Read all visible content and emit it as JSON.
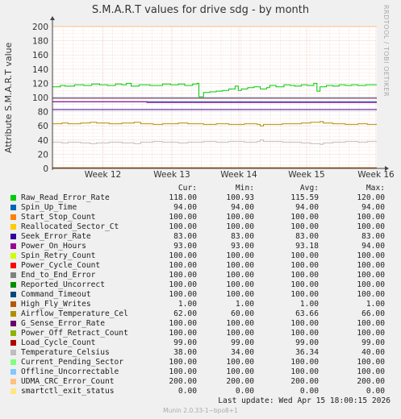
{
  "chart_data": {
    "type": "line",
    "title": "S.M.A.R.T values for drive sdg - by month",
    "ylabel": "Attribute S.M.A.R.T value",
    "xlabel": "",
    "ylim": [
      0,
      200
    ],
    "y_ticks": [
      "0",
      "20",
      "40",
      "60",
      "80",
      "100",
      "120",
      "140",
      "160",
      "180",
      "200"
    ],
    "x_ticks": [
      "Week 12",
      "Week 13",
      "Week 14",
      "Week 15",
      "Week 16"
    ],
    "grid": true,
    "legend_columns": [
      "Cur:",
      "Min:",
      "Avg:",
      "Max:"
    ],
    "series": [
      {
        "name": "Raw_Read_Error_Rate",
        "color": "#00cc00",
        "cur": "118.00",
        "min": "100.93",
        "avg": "115.59",
        "max": "120.00",
        "points": [
          [
            0,
            115
          ],
          [
            5,
            115
          ],
          [
            5,
            117
          ],
          [
            8,
            117
          ],
          [
            8,
            116
          ],
          [
            12,
            116
          ],
          [
            12,
            116
          ],
          [
            14,
            116
          ],
          [
            14,
            118
          ],
          [
            20,
            118
          ],
          [
            20,
            117
          ],
          [
            25,
            117
          ],
          [
            25,
            119
          ],
          [
            30,
            119
          ],
          [
            30,
            118
          ],
          [
            35,
            118
          ],
          [
            35,
            117
          ],
          [
            40,
            117
          ],
          [
            40,
            119
          ],
          [
            44,
            119
          ],
          [
            44,
            118
          ],
          [
            47,
            118
          ],
          [
            47,
            120
          ],
          [
            50,
            120
          ],
          [
            50,
            116
          ],
          [
            55,
            116
          ],
          [
            55,
            118
          ],
          [
            62,
            118
          ],
          [
            62,
            117
          ],
          [
            70,
            117
          ],
          [
            70,
            119
          ],
          [
            75,
            119
          ],
          [
            75,
            118
          ],
          [
            80,
            118
          ],
          [
            80,
            119
          ],
          [
            84,
            119
          ],
          [
            84,
            117
          ],
          [
            89,
            117
          ],
          [
            89,
            119
          ],
          [
            92,
            119
          ],
          [
            92,
            120
          ],
          [
            93,
            120
          ],
          [
            93,
            101
          ],
          [
            96,
            101
          ],
          [
            96,
            107
          ],
          [
            100,
            107
          ],
          [
            100,
            108
          ],
          [
            104,
            108
          ],
          [
            104,
            109
          ],
          [
            108,
            109
          ],
          [
            108,
            110
          ],
          [
            112,
            110
          ],
          [
            112,
            112
          ],
          [
            116,
            112
          ],
          [
            116,
            116
          ],
          [
            118,
            116
          ],
          [
            118,
            110
          ],
          [
            120,
            110
          ],
          [
            120,
            112
          ],
          [
            124,
            112
          ],
          [
            124,
            114
          ],
          [
            128,
            114
          ],
          [
            128,
            115
          ],
          [
            132,
            115
          ],
          [
            132,
            112
          ],
          [
            136,
            112
          ],
          [
            136,
            114
          ],
          [
            138,
            114
          ],
          [
            138,
            117
          ],
          [
            142,
            117
          ],
          [
            142,
            115
          ],
          [
            147,
            115
          ],
          [
            147,
            118
          ],
          [
            151,
            118
          ],
          [
            151,
            117
          ],
          [
            154,
            117
          ],
          [
            154,
            116
          ],
          [
            158,
            116
          ],
          [
            158,
            118
          ],
          [
            162,
            118
          ],
          [
            162,
            117
          ],
          [
            166,
            117
          ],
          [
            166,
            120
          ],
          [
            168,
            120
          ],
          [
            168,
            109
          ],
          [
            170,
            109
          ],
          [
            170,
            115
          ],
          [
            174,
            115
          ],
          [
            174,
            117
          ],
          [
            178,
            117
          ],
          [
            178,
            116
          ],
          [
            182,
            116
          ],
          [
            182,
            118
          ],
          [
            186,
            118
          ],
          [
            186,
            117
          ],
          [
            190,
            117
          ],
          [
            190,
            118
          ],
          [
            194,
            118
          ],
          [
            194,
            117
          ],
          [
            199,
            117
          ],
          [
            199,
            118
          ],
          [
            206,
            118
          ]
        ]
      },
      {
        "name": "Spin_Up_Time",
        "color": "#0066b3",
        "cur": "94.00",
        "min": "94.00",
        "avg": "94.00",
        "max": "94.00",
        "points": [
          [
            0,
            94
          ],
          [
            206,
            94
          ]
        ]
      },
      {
        "name": "Start_Stop_Count",
        "color": "#ff8000",
        "cur": "100.00",
        "min": "100.00",
        "avg": "100.00",
        "max": "100.00",
        "points": [
          [
            0,
            100
          ],
          [
            206,
            100
          ]
        ]
      },
      {
        "name": "Reallocated_Sector_Ct",
        "color": "#ffcc00",
        "cur": "100.00",
        "min": "100.00",
        "avg": "100.00",
        "max": "100.00",
        "points": [
          [
            0,
            100
          ],
          [
            206,
            100
          ]
        ]
      },
      {
        "name": "Seek_Error_Rate",
        "color": "#330099",
        "cur": "83.00",
        "min": "83.00",
        "avg": "83.00",
        "max": "83.00",
        "points": [
          [
            0,
            83
          ],
          [
            206,
            83
          ]
        ]
      },
      {
        "name": "Power_On_Hours",
        "color": "#990099",
        "cur": "93.00",
        "min": "93.00",
        "avg": "93.18",
        "max": "94.00",
        "points": [
          [
            0,
            94
          ],
          [
            60,
            94
          ],
          [
            60,
            93
          ],
          [
            206,
            93
          ]
        ]
      },
      {
        "name": "Spin_Retry_Count",
        "color": "#ccff00",
        "cur": "100.00",
        "min": "100.00",
        "avg": "100.00",
        "max": "100.00",
        "points": [
          [
            0,
            100
          ],
          [
            206,
            100
          ]
        ]
      },
      {
        "name": "Power_Cycle_Count",
        "color": "#ff0000",
        "cur": "100.00",
        "min": "100.00",
        "avg": "100.00",
        "max": "100.00",
        "points": [
          [
            0,
            100
          ],
          [
            206,
            100
          ]
        ]
      },
      {
        "name": "End_to_End_Error",
        "color": "#808080",
        "cur": "100.00",
        "min": "100.00",
        "avg": "100.00",
        "max": "100.00",
        "points": [
          [
            0,
            100
          ],
          [
            206,
            100
          ]
        ]
      },
      {
        "name": "Reported_Uncorrect",
        "color": "#008f00",
        "cur": "100.00",
        "min": "100.00",
        "avg": "100.00",
        "max": "100.00",
        "points": [
          [
            0,
            100
          ],
          [
            206,
            100
          ]
        ]
      },
      {
        "name": "Command_Timeout",
        "color": "#00487d",
        "cur": "100.00",
        "min": "100.00",
        "avg": "100.00",
        "max": "100.00",
        "points": [
          [
            0,
            100
          ],
          [
            206,
            100
          ]
        ]
      },
      {
        "name": "High_Fly_Writes",
        "color": "#b35a00",
        "cur": "1.00",
        "min": "1.00",
        "avg": "1.00",
        "max": "1.00",
        "points": [
          [
            0,
            1
          ],
          [
            206,
            1
          ]
        ]
      },
      {
        "name": "Airflow_Temperature_Cel",
        "color": "#b38f00",
        "cur": "62.00",
        "min": "60.00",
        "avg": "63.66",
        "max": "66.00",
        "points": [
          [
            0,
            63
          ],
          [
            6,
            63
          ],
          [
            6,
            64
          ],
          [
            10,
            64
          ],
          [
            10,
            63
          ],
          [
            18,
            63
          ],
          [
            18,
            64
          ],
          [
            24,
            64
          ],
          [
            24,
            65
          ],
          [
            28,
            65
          ],
          [
            28,
            64
          ],
          [
            36,
            64
          ],
          [
            36,
            63
          ],
          [
            44,
            63
          ],
          [
            44,
            64
          ],
          [
            52,
            64
          ],
          [
            52,
            65
          ],
          [
            56,
            65
          ],
          [
            56,
            63
          ],
          [
            64,
            63
          ],
          [
            64,
            62
          ],
          [
            70,
            62
          ],
          [
            70,
            63
          ],
          [
            80,
            63
          ],
          [
            80,
            64
          ],
          [
            86,
            64
          ],
          [
            86,
            63
          ],
          [
            96,
            63
          ],
          [
            96,
            62
          ],
          [
            104,
            62
          ],
          [
            104,
            63
          ],
          [
            112,
            63
          ],
          [
            112,
            62
          ],
          [
            122,
            62
          ],
          [
            122,
            63
          ],
          [
            130,
            63
          ],
          [
            130,
            62
          ],
          [
            132,
            62
          ],
          [
            132,
            60
          ],
          [
            134,
            60
          ],
          [
            134,
            62
          ],
          [
            146,
            62
          ],
          [
            146,
            63
          ],
          [
            158,
            63
          ],
          [
            158,
            64
          ],
          [
            164,
            64
          ],
          [
            164,
            65
          ],
          [
            170,
            65
          ],
          [
            170,
            66
          ],
          [
            172,
            66
          ],
          [
            172,
            64
          ],
          [
            178,
            64
          ],
          [
            178,
            63
          ],
          [
            186,
            63
          ],
          [
            186,
            62
          ],
          [
            194,
            62
          ],
          [
            194,
            63
          ],
          [
            200,
            63
          ],
          [
            200,
            62
          ],
          [
            206,
            62
          ]
        ]
      },
      {
        "name": "G_Sense_Error_Rate",
        "color": "#6b006b",
        "cur": "100.00",
        "min": "100.00",
        "avg": "100.00",
        "max": "100.00",
        "points": [
          [
            0,
            100
          ],
          [
            206,
            100
          ]
        ]
      },
      {
        "name": "Power_Off_Retract_Count",
        "color": "#8fb300",
        "cur": "100.00",
        "min": "100.00",
        "avg": "100.00",
        "max": "100.00",
        "points": [
          [
            0,
            100
          ],
          [
            206,
            100
          ]
        ]
      },
      {
        "name": "Load_Cycle_Count",
        "color": "#b30000",
        "cur": "99.00",
        "min": "99.00",
        "avg": "99.00",
        "max": "99.00",
        "points": [
          [
            0,
            99
          ],
          [
            206,
            99
          ]
        ]
      },
      {
        "name": "Temperature_Celsius",
        "color": "#bebebe",
        "cur": "38.00",
        "min": "34.00",
        "avg": "36.34",
        "max": "40.00",
        "points": [
          [
            0,
            37
          ],
          [
            6,
            37
          ],
          [
            6,
            36
          ],
          [
            10,
            36
          ],
          [
            10,
            37
          ],
          [
            18,
            37
          ],
          [
            18,
            36
          ],
          [
            24,
            36
          ],
          [
            24,
            35
          ],
          [
            28,
            35
          ],
          [
            28,
            36
          ],
          [
            36,
            36
          ],
          [
            36,
            37
          ],
          [
            44,
            37
          ],
          [
            44,
            36
          ],
          [
            52,
            36
          ],
          [
            52,
            35
          ],
          [
            56,
            35
          ],
          [
            56,
            37
          ],
          [
            64,
            37
          ],
          [
            64,
            38
          ],
          [
            70,
            38
          ],
          [
            70,
            37
          ],
          [
            80,
            37
          ],
          [
            80,
            36
          ],
          [
            86,
            36
          ],
          [
            86,
            37
          ],
          [
            96,
            37
          ],
          [
            96,
            38
          ],
          [
            104,
            38
          ],
          [
            104,
            37
          ],
          [
            112,
            37
          ],
          [
            112,
            38
          ],
          [
            122,
            38
          ],
          [
            122,
            37
          ],
          [
            130,
            37
          ],
          [
            130,
            38
          ],
          [
            132,
            38
          ],
          [
            132,
            40
          ],
          [
            134,
            40
          ],
          [
            134,
            38
          ],
          [
            146,
            38
          ],
          [
            146,
            37
          ],
          [
            158,
            37
          ],
          [
            158,
            36
          ],
          [
            164,
            36
          ],
          [
            164,
            35
          ],
          [
            170,
            35
          ],
          [
            170,
            34
          ],
          [
            172,
            34
          ],
          [
            172,
            36
          ],
          [
            178,
            36
          ],
          [
            178,
            37
          ],
          [
            186,
            37
          ],
          [
            186,
            38
          ],
          [
            194,
            38
          ],
          [
            194,
            37
          ],
          [
            200,
            37
          ],
          [
            200,
            38
          ],
          [
            206,
            38
          ]
        ]
      },
      {
        "name": "Current_Pending_Sector",
        "color": "#80ff80",
        "cur": "100.00",
        "min": "100.00",
        "avg": "100.00",
        "max": "100.00",
        "points": [
          [
            0,
            100
          ],
          [
            206,
            100
          ]
        ]
      },
      {
        "name": "Offline_Uncorrectable",
        "color": "#80c9ff",
        "cur": "100.00",
        "min": "100.00",
        "avg": "100.00",
        "max": "100.00",
        "points": [
          [
            0,
            100
          ],
          [
            206,
            100
          ]
        ]
      },
      {
        "name": "UDMA_CRC_Error_Count",
        "color": "#ffc080",
        "cur": "200.00",
        "min": "200.00",
        "avg": "200.00",
        "max": "200.00",
        "points": [
          [
            0,
            200
          ],
          [
            206,
            200
          ]
        ]
      },
      {
        "name": "smartctl_exit_status",
        "color": "#ffe680",
        "cur": "0.00",
        "min": "0.00",
        "avg": "0.00",
        "max": "0.00",
        "points": [
          [
            0,
            0
          ],
          [
            206,
            0
          ]
        ]
      }
    ]
  },
  "last_update": "Last update: Wed Apr 15 18:00:15 2026",
  "footer": "Munin 2.0.33-1~bpo8+1",
  "watermark": "RRDTOOL / TOBI OETIKER"
}
